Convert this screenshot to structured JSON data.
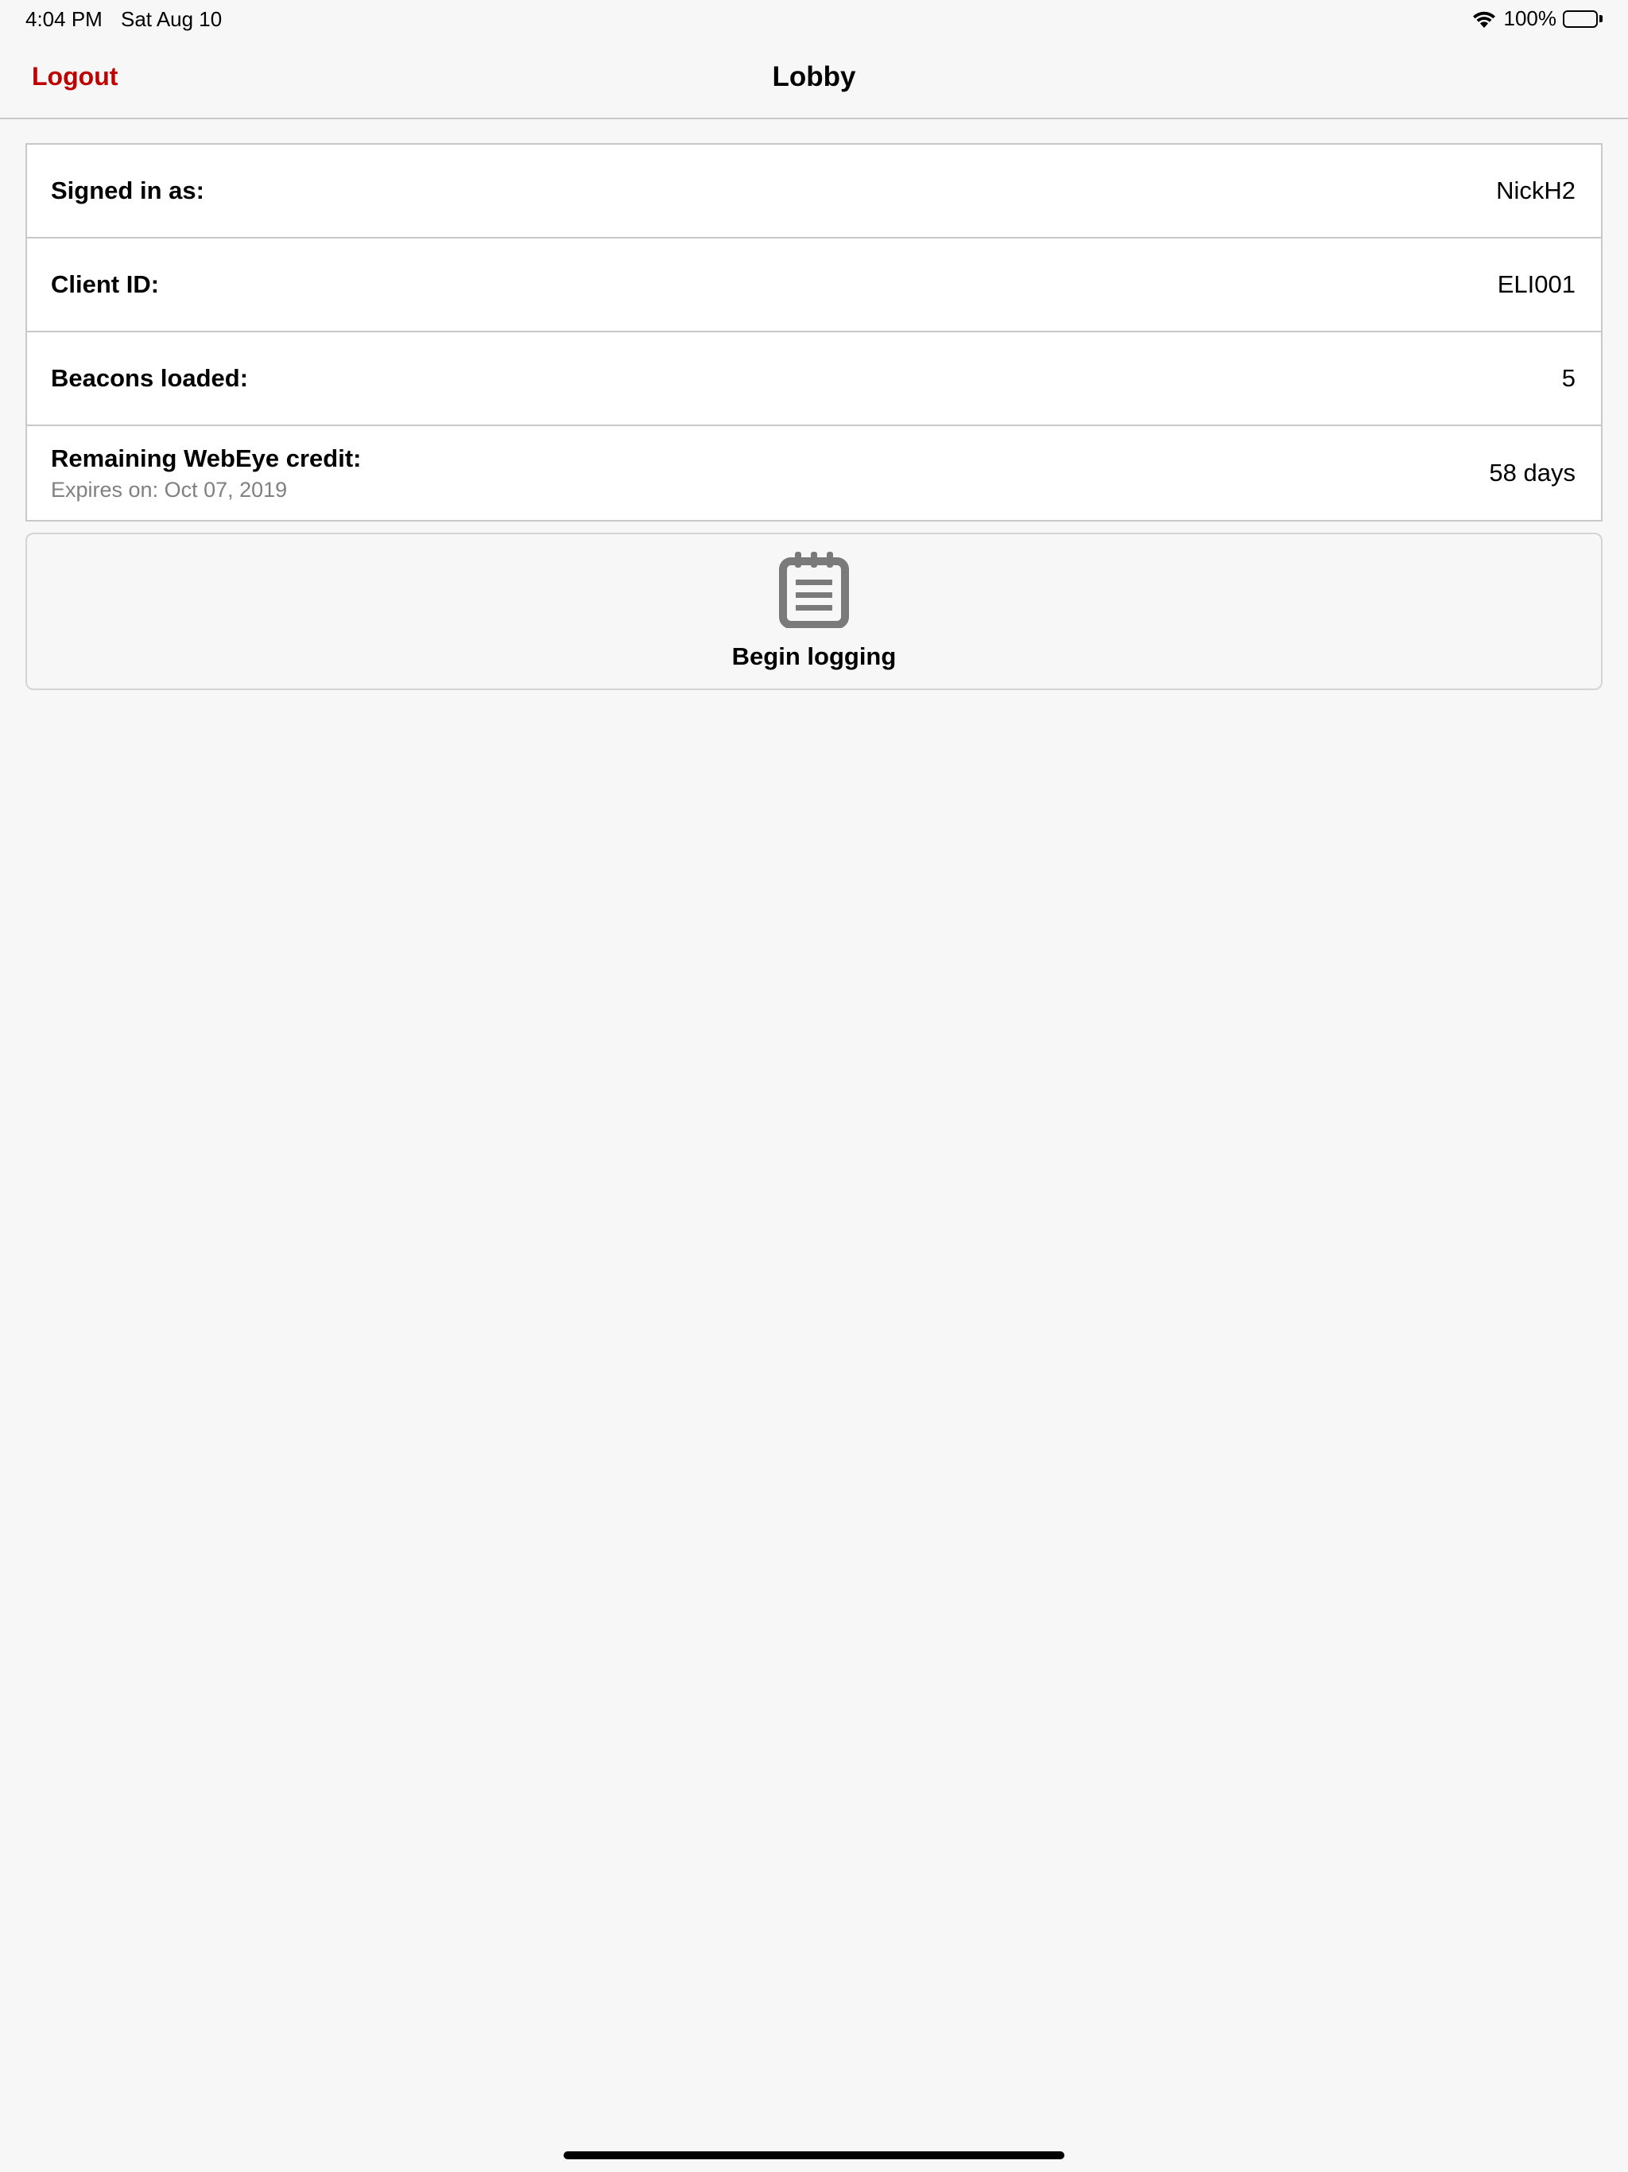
{
  "status_bar": {
    "time": "4:04 PM",
    "date": "Sat Aug 10",
    "battery": "100%",
    "icons": [
      "wifi-icon",
      "battery-icon"
    ]
  },
  "nav": {
    "title": "Lobby",
    "logout_label": "Logout",
    "accent_color": "#c00000"
  },
  "info": {
    "rows": [
      {
        "label": "Signed in as:",
        "value": "NickH2"
      },
      {
        "label": "Client ID:",
        "value": "ELI001"
      },
      {
        "label": "Beacons loaded:",
        "value": "5"
      },
      {
        "label": "Remaining WebEye credit:",
        "sublabel": "Expires on: Oct 07, 2019",
        "value": "58 days"
      }
    ]
  },
  "actions": {
    "begin_logging_label": "Begin logging",
    "begin_logging_icon": "clipboard-icon"
  }
}
